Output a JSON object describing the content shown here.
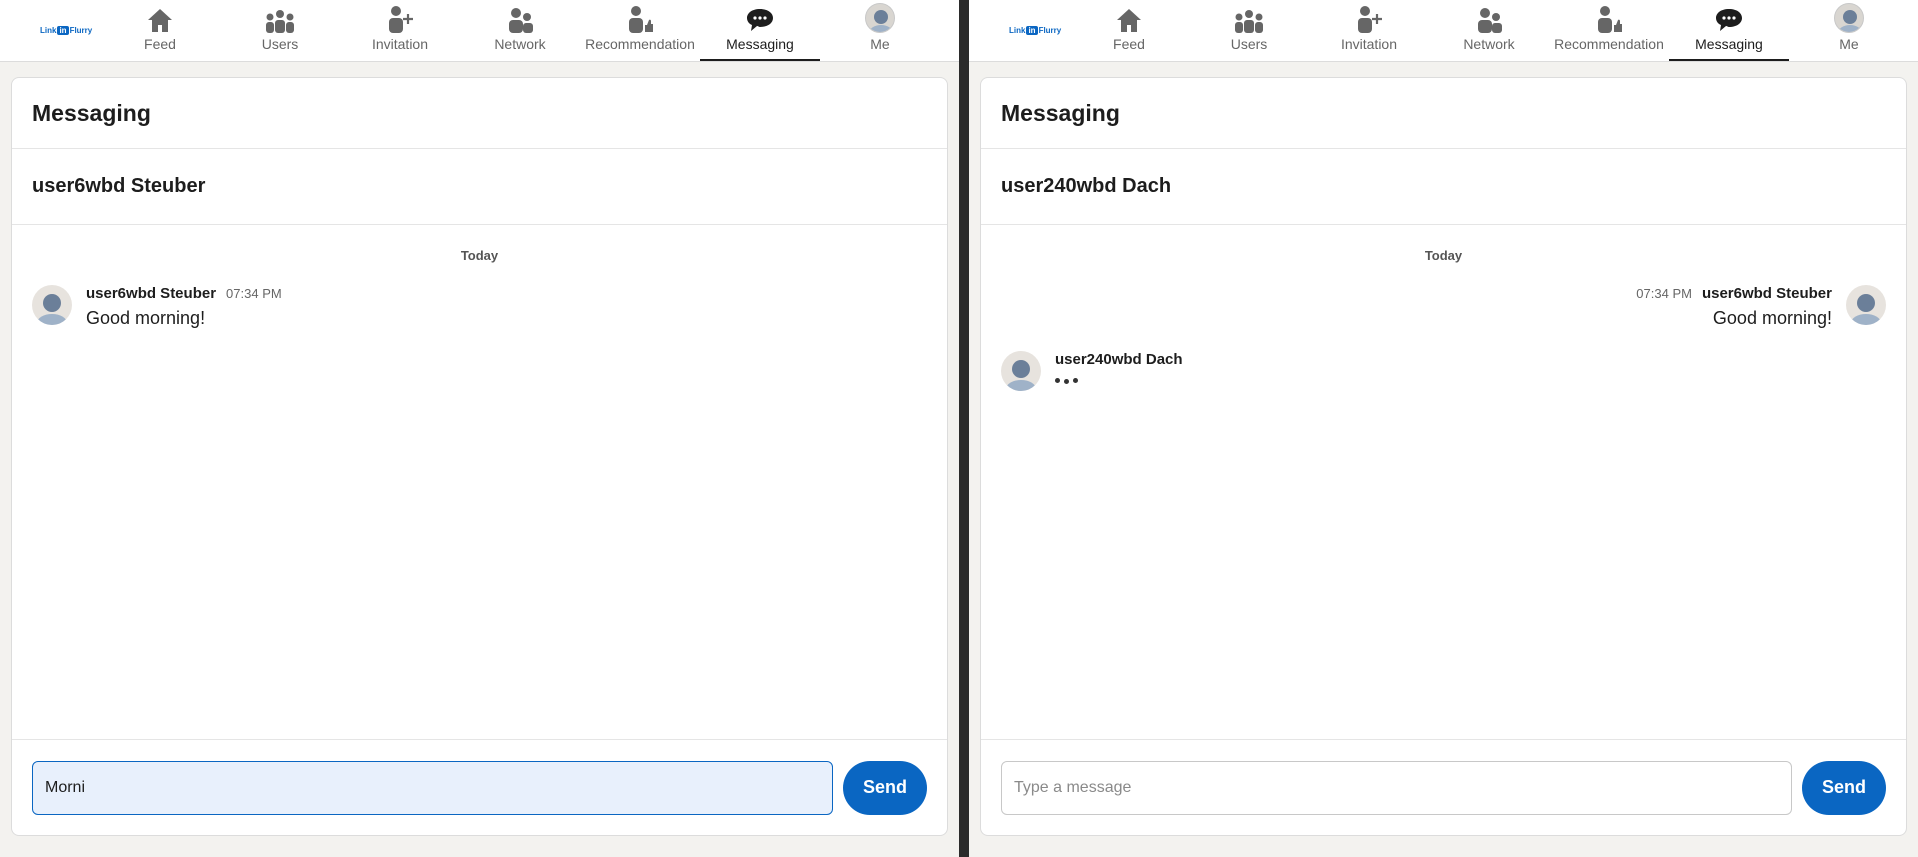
{
  "nav": {
    "logo": {
      "prefix": "Link",
      "in": "in",
      "suffix": "Flurry"
    },
    "items": [
      {
        "label": "Feed",
        "icon": "home-icon"
      },
      {
        "label": "Users",
        "icon": "users-icon"
      },
      {
        "label": "Invitation",
        "icon": "add-person-icon"
      },
      {
        "label": "Network",
        "icon": "network-icon"
      },
      {
        "label": "Recommendation",
        "icon": "recommend-icon"
      },
      {
        "label": "Messaging",
        "icon": "chat-icon"
      },
      {
        "label": "Me",
        "icon": "avatar"
      }
    ],
    "active": "Messaging"
  },
  "left": {
    "title": "Messaging",
    "conversation": "user6wbd Steuber",
    "day": "Today",
    "messages": [
      {
        "sender": "user6wbd Steuber",
        "time": "07:34 PM",
        "text": "Good morning!"
      }
    ],
    "compose": {
      "value": "Morni",
      "placeholder": "Type a message"
    },
    "send_label": "Send"
  },
  "right": {
    "title": "Messaging",
    "conversation": "user240wbd Dach",
    "day": "Today",
    "messages": [
      {
        "sender": "user6wbd Steuber",
        "time": "07:34 PM",
        "text": "Good morning!",
        "direction": "outgoing"
      },
      {
        "sender": "user240wbd Dach",
        "typing": true,
        "direction": "incoming"
      }
    ],
    "compose": {
      "value": "",
      "placeholder": "Type a message"
    },
    "send_label": "Send"
  },
  "colors": {
    "accent": "#0a66c2",
    "background": "#f3f2ef"
  }
}
